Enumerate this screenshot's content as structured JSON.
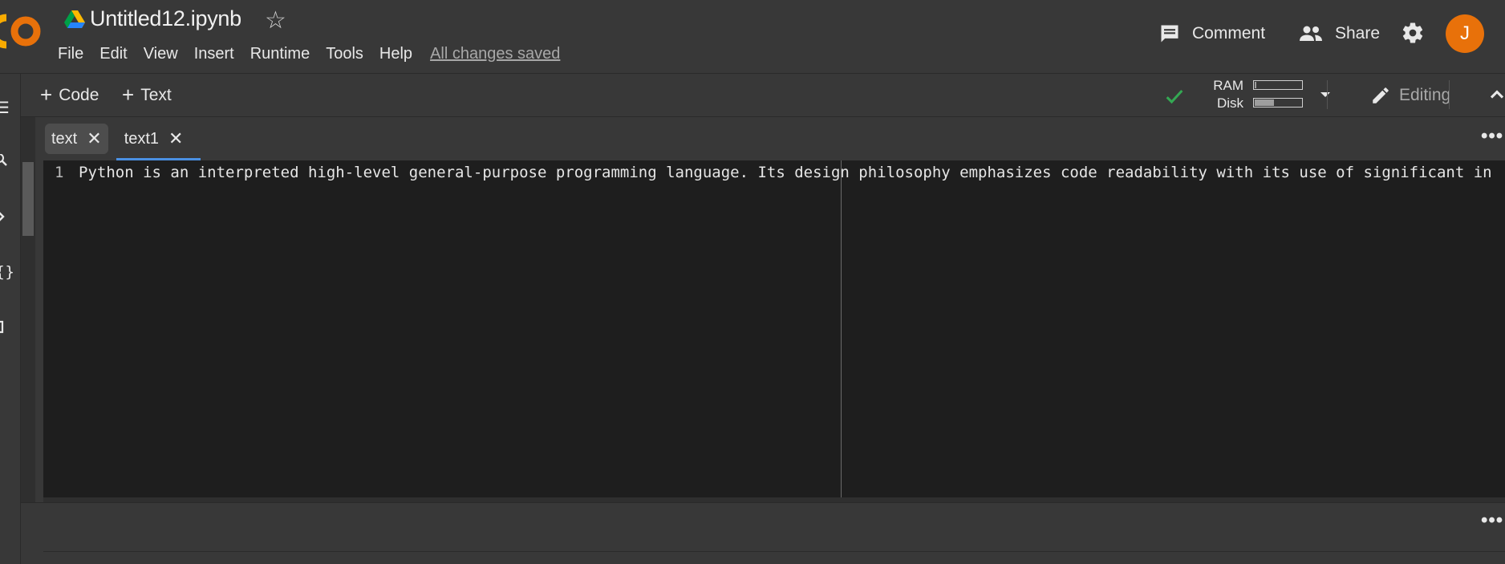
{
  "header": {
    "title": "Untitled12.ipynb",
    "menu": [
      "File",
      "Edit",
      "View",
      "Insert",
      "Runtime",
      "Tools",
      "Help"
    ],
    "save_status": "All changes saved",
    "comment_label": "Comment",
    "share_label": "Share",
    "avatar_initial": "J"
  },
  "toolbar": {
    "add_code_label": "Code",
    "add_text_label": "Text",
    "ram_label": "RAM",
    "disk_label": "Disk",
    "ram_usage": 0.03,
    "disk_usage": 0.4,
    "editing_label": "Editing"
  },
  "editor": {
    "tabs": [
      {
        "label": "text",
        "active": false
      },
      {
        "label": "text1",
        "active": true
      }
    ],
    "lines": [
      {
        "number": "1",
        "text": "Python is an interpreted high-level general-purpose programming language. Its design philosophy emphasizes code readability with its use of significant in"
      }
    ]
  },
  "icons": {
    "drive": "google-drive-icon",
    "star": "star-icon",
    "comment": "comment-icon",
    "share": "people-icon",
    "settings": "gear-icon",
    "check": "checkmark-icon",
    "dropdown": "caret-down-icon",
    "editing": "pencil-icon",
    "collapse": "chevron-up-icon",
    "more": "more-horizontal-icon"
  },
  "colors": {
    "background": "#383838",
    "editor_bg": "#1e1e1e",
    "avatar": "#e8710a",
    "active_tab_underline": "#4a90e2",
    "check": "#34a853"
  }
}
